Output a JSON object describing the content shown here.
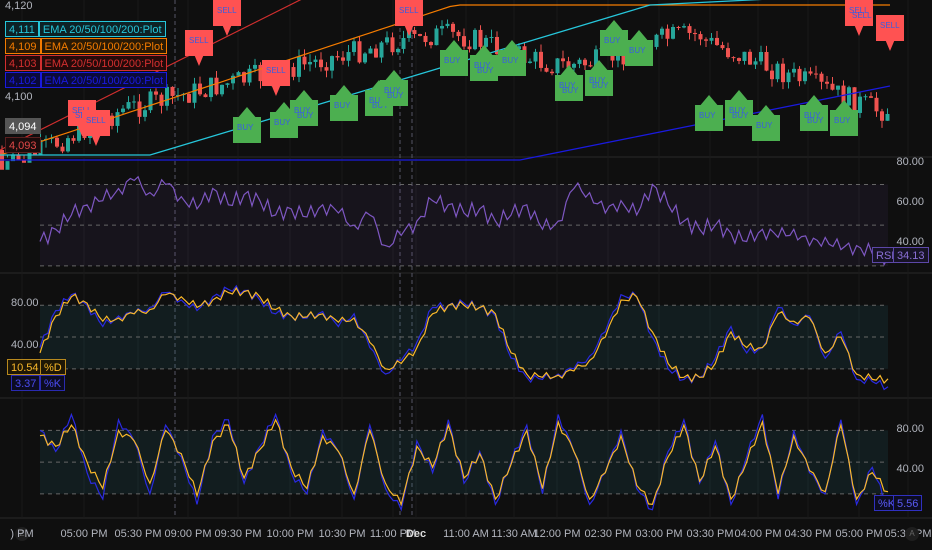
{
  "price_axis": {
    "ticks": [
      "4,120",
      "4,100"
    ],
    "last_price": "4,094",
    "prev_price": "4,093"
  },
  "legend": [
    {
      "value": "4,111",
      "label": "EMA 20/50/100/200:Plot",
      "color": "#26c6da"
    },
    {
      "value": "4,109",
      "label": "EMA 20/50/100/200:Plot",
      "color": "#f57c00"
    },
    {
      "value": "4,103",
      "label": "EMA 20/50/100/200:Plot",
      "color": "#d32f2f"
    },
    {
      "value": "4,102",
      "label": "EMA 20/50/100/200:Plot",
      "color": "#1a1adf"
    }
  ],
  "signals": {
    "buy": "BUY",
    "sell": "SELL"
  },
  "rsi_pane": {
    "ticks": [
      "80.00",
      "60.00",
      "40.00"
    ],
    "name": "RSI",
    "value": "34.13"
  },
  "stoch_pane": {
    "ticks": [
      "80.00",
      "40.00"
    ],
    "d_value": "10.54",
    "d_name": "%D",
    "k_value": "3.37",
    "k_name": "%K"
  },
  "stochrsi_pane": {
    "ticks": [
      "80.00",
      "40.00"
    ],
    "k_name": "%K",
    "k_value": "5.56"
  },
  "time_axis": {
    "labels": [
      ") PM",
      "05:00 PM",
      "05:30 PM",
      "09:00 PM",
      "09:30 PM",
      "10:00 PM",
      "10:30 PM",
      "11:00 PM",
      "Dec",
      "11:00 AM",
      "11:30 AM",
      "12:00 PM",
      "02:30 PM",
      "03:00 PM",
      "03:30 PM",
      "04:00 PM",
      "04:30 PM",
      "05:00 PM",
      "05:30 PM"
    ],
    "left_button": "Z",
    "right_button": "A"
  },
  "colors": {
    "rsi": "#7e57c2",
    "k": "#2a2ae0",
    "d": "#f9b82a",
    "buy": "#4caf50",
    "sell": "#ff5252",
    "up": "#26a69a",
    "down": "#ef5350"
  },
  "chart_data": [
    {
      "type": "line",
      "title": "RSI",
      "ylim": [
        30,
        85
      ],
      "series": [
        {
          "name": "RSI",
          "values": [
            42,
            48,
            55,
            60,
            62,
            68,
            72,
            66,
            70,
            64,
            58,
            68,
            60,
            65,
            62,
            55,
            58,
            54,
            60,
            56,
            50,
            55,
            40,
            45,
            52,
            62,
            60,
            56,
            58,
            52,
            55,
            60,
            48,
            52,
            68,
            66,
            56,
            62,
            55,
            70,
            60,
            52,
            48,
            50,
            46,
            42,
            48,
            44,
            48,
            40,
            44,
            38,
            40,
            36,
            34
          ]
        }
      ]
    },
    {
      "type": "line",
      "title": "Stoch",
      "ylim": [
        0,
        100
      ],
      "series": [
        {
          "name": "%K",
          "values": [
            40,
            75,
            90,
            80,
            60,
            70,
            72,
            78,
            92,
            85,
            75,
            88,
            95,
            94,
            85,
            72,
            70,
            68,
            74,
            60,
            72,
            40,
            15,
            28,
            45,
            78,
            80,
            82,
            78,
            70,
            30,
            12,
            10,
            15,
            20,
            32,
            55,
            90,
            88,
            50,
            20,
            10,
            12,
            30,
            60,
            35,
            40,
            78,
            62,
            70,
            30,
            55,
            10,
            8,
            3
          ]
        },
        {
          "name": "%D",
          "values": [
            35,
            70,
            88,
            82,
            65,
            68,
            72,
            76,
            90,
            88,
            78,
            85,
            92,
            93,
            88,
            76,
            70,
            69,
            72,
            64,
            68,
            45,
            20,
            25,
            40,
            72,
            80,
            80,
            78,
            72,
            35,
            15,
            12,
            14,
            18,
            28,
            50,
            85,
            88,
            55,
            25,
            12,
            12,
            25,
            55,
            40,
            40,
            72,
            65,
            68,
            35,
            50,
            15,
            10,
            10.54
          ]
        }
      ]
    },
    {
      "type": "line",
      "title": "Stoch RSI",
      "ylim": [
        0,
        100
      ],
      "series": [
        {
          "name": "%K",
          "values": [
            80,
            60,
            95,
            40,
            15,
            90,
            70,
            20,
            85,
            55,
            10,
            75,
            90,
            30,
            65,
            95,
            40,
            20,
            80,
            60,
            15,
            85,
            25,
            5,
            70,
            40,
            90,
            30,
            60,
            10,
            50,
            85,
            20,
            95,
            60,
            10,
            40,
            80,
            25,
            5,
            60,
            90,
            30,
            70,
            10,
            55,
            95,
            15,
            80,
            40,
            20,
            90,
            10,
            45,
            5.56
          ]
        },
        {
          "name": "%D",
          "values": [
            75,
            65,
            85,
            50,
            25,
            80,
            70,
            30,
            80,
            58,
            18,
            70,
            85,
            35,
            62,
            90,
            45,
            25,
            75,
            60,
            20,
            80,
            30,
            10,
            65,
            45,
            85,
            35,
            58,
            15,
            48,
            80,
            25,
            88,
            60,
            15,
            40,
            75,
            28,
            10,
            55,
            85,
            32,
            65,
            15,
            50,
            88,
            20,
            75,
            42,
            22,
            85,
            15,
            40,
            22
          ]
        }
      ]
    }
  ]
}
